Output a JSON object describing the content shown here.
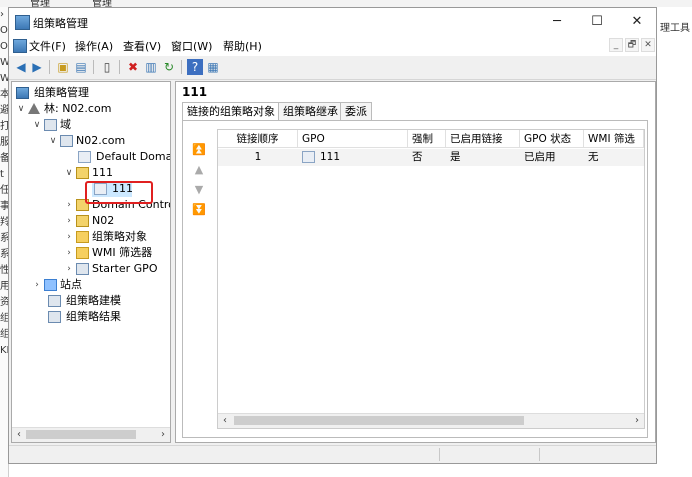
{
  "background_window": {
    "tabs": [
      "管理",
      "管理"
    ],
    "left_chars": [
      "›",
      "O",
      "O",
      "W",
      "W",
      "本",
      "避",
      "打",
      "服",
      "备",
      "t",
      "任",
      "事",
      "羚",
      "系",
      "系",
      "性",
      "用",
      "资",
      "组",
      "组",
      "KB"
    ],
    "right_text": "理工具"
  },
  "window": {
    "title": "组策略管理",
    "controls": {
      "minimize": "─",
      "maximize": "☐",
      "close": "✕"
    }
  },
  "menu": {
    "items": [
      "文件(F)",
      "操作(A)",
      "查看(V)",
      "窗口(W)",
      "帮助(H)"
    ],
    "mdi": [
      "_",
      "🗗",
      "✕"
    ]
  },
  "toolbar": {
    "icons": [
      "back-icon",
      "forward-icon",
      "up-folder-icon",
      "show-tree-icon",
      "properties-icon",
      "delete-icon",
      "export-icon",
      "refresh-icon",
      "help-icon",
      "console-icon"
    ]
  },
  "tree": {
    "root": "组策略管理",
    "forest": "林: N02.com",
    "domains": "域",
    "domain": "N02.com",
    "default_domain": "Default Domai",
    "ou": "111",
    "gpo_link": "111",
    "domain_controllers": "Domain Contro",
    "n02": "N02",
    "gpo_objects": "组策略对象",
    "wmi_filters": "WMI 筛选器",
    "starter_gpo": "Starter GPO",
    "sites": "站点",
    "modeling": "组策略建模",
    "results": "组策略结果"
  },
  "right": {
    "title": "111",
    "tabs": [
      "链接的组策略对象",
      "组策略继承",
      "委派"
    ],
    "columns": [
      "链接顺序",
      "GPO",
      "强制",
      "已启用链接",
      "GPO 状态",
      "WMI 筛选"
    ],
    "rows": [
      {
        "order": "1",
        "gpo": "111",
        "enforced": "否",
        "link_enabled": "是",
        "status": "已启用",
        "wmi": "无"
      }
    ],
    "arrows": [
      "⏫",
      "▲",
      "▼",
      "⏬"
    ]
  },
  "colors": {
    "highlight": "#e02020",
    "selection": "#cce8ff"
  }
}
